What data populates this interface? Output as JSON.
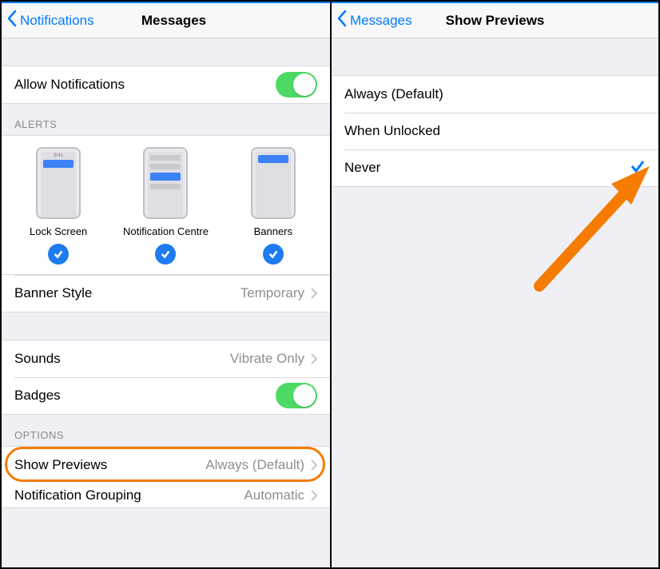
{
  "left": {
    "back_label": "Notifications",
    "title": "Messages",
    "allow_label": "Allow Notifications",
    "alerts_header": "ALERTS",
    "alert_options": [
      {
        "label": "Lock Screen"
      },
      {
        "label": "Notification Centre"
      },
      {
        "label": "Banners"
      }
    ],
    "phone_time": "9:41",
    "banner_style": {
      "label": "Banner Style",
      "value": "Temporary"
    },
    "sounds": {
      "label": "Sounds",
      "value": "Vibrate Only"
    },
    "badges_label": "Badges",
    "options_header": "OPTIONS",
    "show_previews": {
      "label": "Show Previews",
      "value": "Always (Default)"
    },
    "notification_grouping": {
      "label": "Notification Grouping",
      "value": "Automatic"
    }
  },
  "right": {
    "back_label": "Messages",
    "title": "Show Previews",
    "options": [
      {
        "label": "Always (Default)",
        "selected": false
      },
      {
        "label": "When Unlocked",
        "selected": false
      },
      {
        "label": "Never",
        "selected": true
      }
    ]
  },
  "colors": {
    "accent": "#007aff",
    "toggle_on": "#4cd964",
    "highlight": "#f57c00"
  }
}
